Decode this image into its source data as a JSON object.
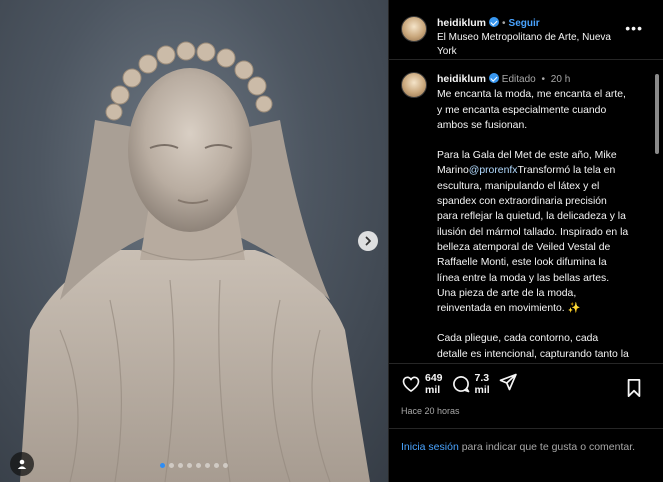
{
  "post": {
    "username": "heidiklum",
    "follow_label": "Seguir",
    "location": "El Museo Metropolitano de Arte, Nueva York",
    "more_label": "•••"
  },
  "caption": {
    "username": "heidiklum",
    "edited_label": "Editado",
    "time_ago": "20 h",
    "paragraph1": "Me encanta la moda, me encanta el arte, y me encanta especialmente cuando ambos se fusionan.",
    "paragraph2_a": "Para la Gala del Met de este año, Mike Marino",
    "paragraph2_mention": "@prorenfx",
    "paragraph2_b": "Transformó la tela en escultura, manipulando el látex y el spandex con extraordinaria precisión para reflejar la quietud, la delicadeza y la ilusión del mármol tallado. Inspirado en la belleza atemporal de Veiled Vestal de Raffaelle Monti, este look difumina la línea entre la moda y las bellas artes. Una pieza de arte de la moda, reinventada en movimiento. ✨",
    "paragraph3": "Cada pliegue, cada contorno, cada detalle es intencional, capturando tanto la fuerza como la suavidad de una manera que parece casi imposible."
  },
  "actions": {
    "likes_line1": "649",
    "likes_line2": "mil",
    "comments_line1": "7.3",
    "comments_line2": "mil",
    "posted_time": "Hace 20 horas"
  },
  "login_prompt": {
    "link": "Inicia sesión",
    "text": " para indicar que te gusta o comentar."
  },
  "carousel": {
    "total_slides": 8,
    "active_index": 0
  },
  "colors": {
    "accent": "#4aa4ff",
    "verified": "#3897f0",
    "background": "#000000"
  }
}
